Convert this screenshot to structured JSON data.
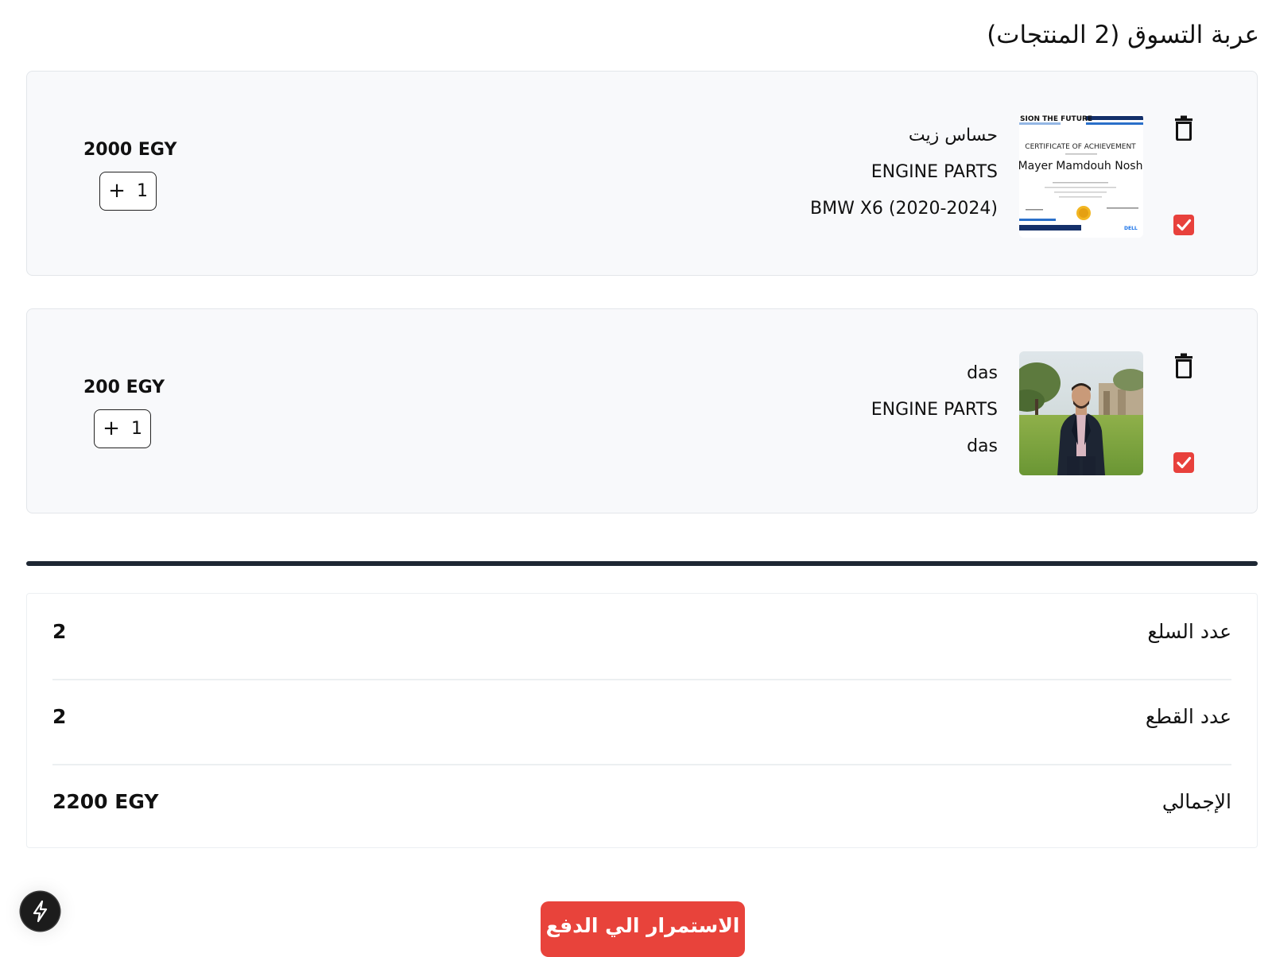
{
  "cart": {
    "title": "عربة التسوق (2 المنتجات)"
  },
  "items": [
    {
      "name": "حساس زيت",
      "category": "ENGINE PARTS",
      "model": "BMW X6 (2020-2024)",
      "price": "2000 EGY",
      "quantity": "1",
      "checked": true,
      "image": {
        "header": "SION THE FUTURE",
        "title": "CERTIFICATE OF ACHIEVEMENT",
        "recipient": "Mayer Mamdouh Nosh",
        "brand": "DELL"
      }
    },
    {
      "name": "das",
      "category": "ENGINE PARTS",
      "model": "das",
      "price": "200 EGY",
      "quantity": "1",
      "checked": true
    }
  ],
  "summary": {
    "rows": [
      {
        "label": "عدد السلع",
        "value": "2"
      },
      {
        "label": "عدد القطع",
        "value": "2"
      },
      {
        "label": "الإجمالي",
        "value": "2200 EGY"
      }
    ]
  },
  "actions": {
    "checkout_label": "الاستمرار الي الدفع"
  },
  "colors": {
    "accent": "#e8433b",
    "divider": "#1e2733",
    "card_bg": "#f8f9fb"
  },
  "icons": {
    "delete": "trash-icon",
    "select": "checkbox-checked-icon",
    "increase": "plus-icon",
    "dev": "bolt-icon"
  }
}
